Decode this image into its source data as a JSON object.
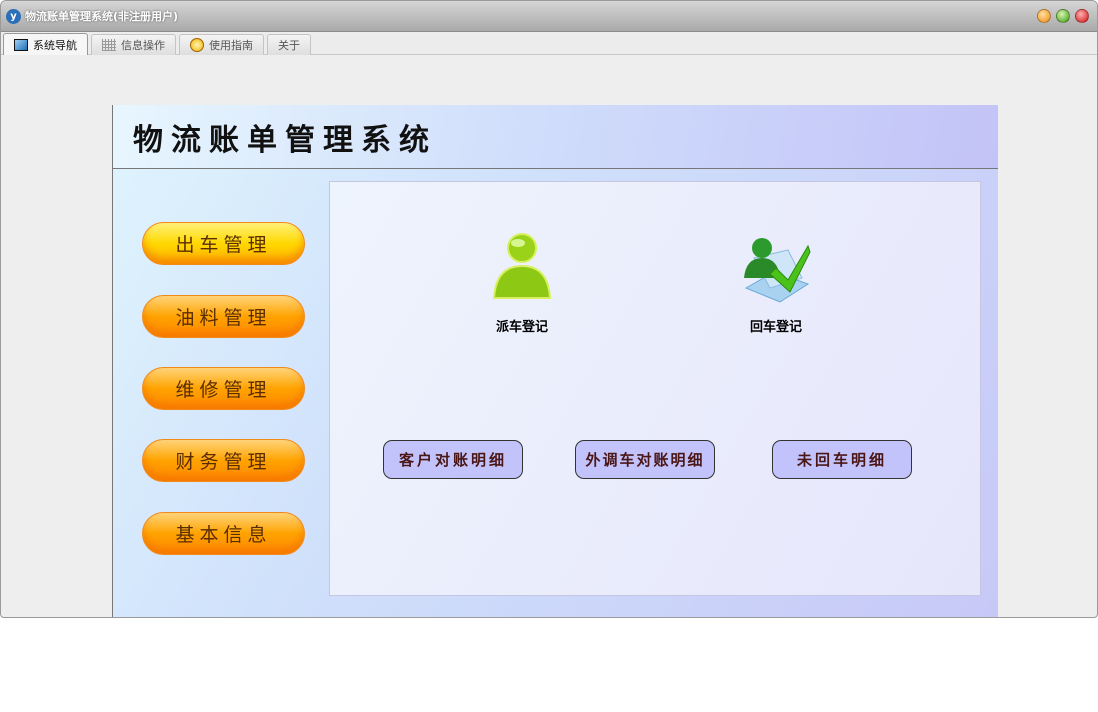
{
  "window": {
    "title": "物流账单管理系统(非注册用户)"
  },
  "tabs": [
    {
      "label": "系统导航"
    },
    {
      "label": "信息操作"
    },
    {
      "label": "使用指南"
    },
    {
      "label": "关于"
    }
  ],
  "header": {
    "title": "物流账单管理系统"
  },
  "sidebar": {
    "items": [
      {
        "label": "出车管理"
      },
      {
        "label": "油料管理"
      },
      {
        "label": "维修管理"
      },
      {
        "label": "财务管理"
      },
      {
        "label": "基本信息"
      }
    ]
  },
  "main": {
    "icons": [
      {
        "label": "派车登记"
      },
      {
        "label": "回车登记"
      }
    ],
    "buttons": [
      {
        "label": "客户对账明细"
      },
      {
        "label": "外调车对账明细"
      },
      {
        "label": "未回车明细"
      }
    ]
  }
}
